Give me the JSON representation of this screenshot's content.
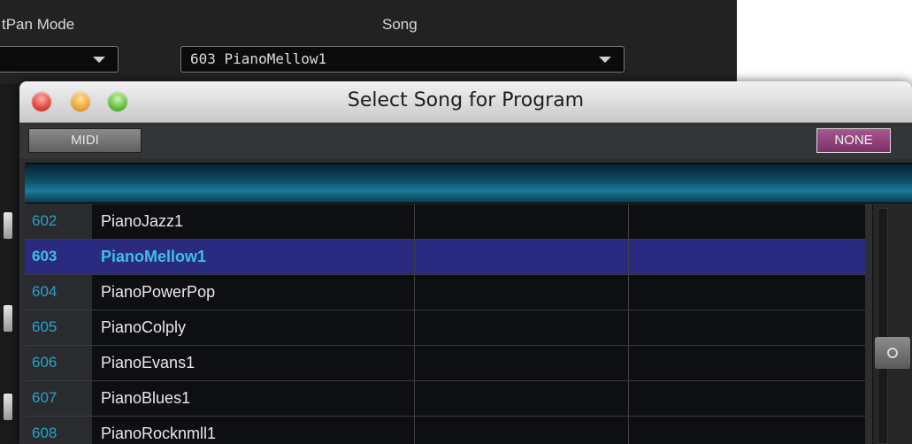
{
  "background_app": {
    "pan_mode_label": "tPan Mode",
    "song_label": "Song",
    "pan_mode_value": "",
    "song_value": "603 PianoMellow1"
  },
  "dialog": {
    "title": "Select Song for Program",
    "midi_button": "MIDI",
    "none_button": "NONE",
    "colors": {
      "header_accent": "#1a7a98",
      "selected_row": "#2a2a80",
      "number_text": "#2aa0c8",
      "none_button": "#7c2f68"
    }
  },
  "songs": [
    {
      "num": "602",
      "name": "PianoJazz1",
      "selected": false
    },
    {
      "num": "603",
      "name": "PianoMellow1",
      "selected": true
    },
    {
      "num": "604",
      "name": "PianoPowerPop",
      "selected": false
    },
    {
      "num": "605",
      "name": "PianoColply",
      "selected": false
    },
    {
      "num": "606",
      "name": "PianoEvans1",
      "selected": false
    },
    {
      "num": "607",
      "name": "PianoBlues1",
      "selected": false
    },
    {
      "num": "608",
      "name": "PianoRocknmll1",
      "selected": false
    }
  ]
}
